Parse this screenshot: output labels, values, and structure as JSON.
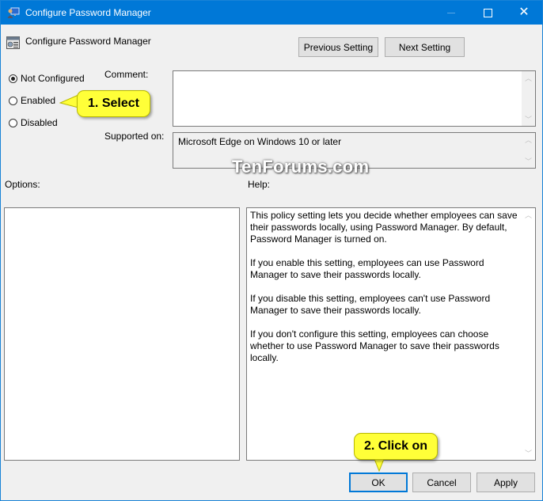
{
  "window": {
    "title": "Configure Password Manager",
    "controls": {
      "minimize": "minimize",
      "maximize": "maximize",
      "close": "close"
    },
    "accent_color": "#0078d7"
  },
  "header": {
    "policy_title": "Configure Password Manager",
    "previous_button": "Previous Setting",
    "next_button": "Next Setting"
  },
  "state": {
    "options": [
      {
        "label": "Not Configured",
        "checked": true
      },
      {
        "label": "Enabled",
        "checked": false
      },
      {
        "label": "Disabled",
        "checked": false
      }
    ]
  },
  "comment": {
    "label": "Comment:",
    "value": ""
  },
  "supported": {
    "label": "Supported on:",
    "value": "Microsoft Edge on Windows 10 or later"
  },
  "options_panel": {
    "label": "Options:"
  },
  "help_panel": {
    "label": "Help:",
    "paragraphs": [
      "This policy setting lets you decide whether employees can save their passwords locally, using Password Manager. By default, Password Manager is turned on.",
      "If you enable this setting, employees can use Password Manager to save their passwords locally.",
      "If you disable this setting, employees can't use Password Manager to save their passwords locally.",
      "If you don't configure this setting, employees can choose whether to use Password Manager to save their passwords locally."
    ]
  },
  "footer": {
    "ok": "OK",
    "cancel": "Cancel",
    "apply": "Apply"
  },
  "annotations": {
    "callout1": "1. Select",
    "callout2": "2. Click on",
    "watermark": "TenForums.com",
    "callout_color": "#ffff38"
  }
}
